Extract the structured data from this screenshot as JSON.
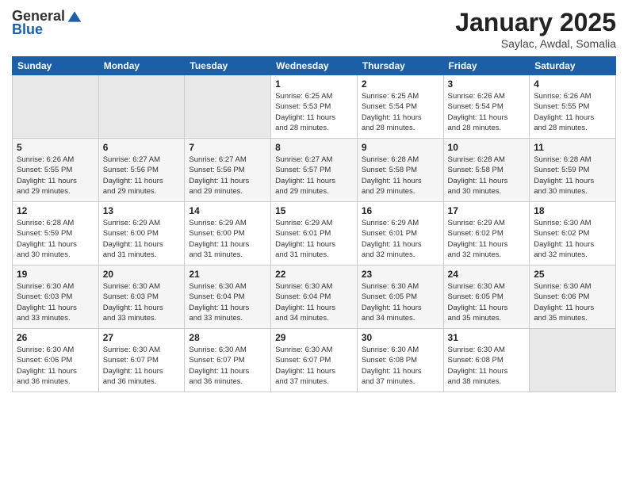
{
  "logo": {
    "general": "General",
    "blue": "Blue"
  },
  "header": {
    "month": "January 2025",
    "location": "Saylac, Awdal, Somalia"
  },
  "weekdays": [
    "Sunday",
    "Monday",
    "Tuesday",
    "Wednesday",
    "Thursday",
    "Friday",
    "Saturday"
  ],
  "weeks": [
    [
      {
        "day": "",
        "info": ""
      },
      {
        "day": "",
        "info": ""
      },
      {
        "day": "",
        "info": ""
      },
      {
        "day": "1",
        "info": "Sunrise: 6:25 AM\nSunset: 5:53 PM\nDaylight: 11 hours\nand 28 minutes."
      },
      {
        "day": "2",
        "info": "Sunrise: 6:25 AM\nSunset: 5:54 PM\nDaylight: 11 hours\nand 28 minutes."
      },
      {
        "day": "3",
        "info": "Sunrise: 6:26 AM\nSunset: 5:54 PM\nDaylight: 11 hours\nand 28 minutes."
      },
      {
        "day": "4",
        "info": "Sunrise: 6:26 AM\nSunset: 5:55 PM\nDaylight: 11 hours\nand 28 minutes."
      }
    ],
    [
      {
        "day": "5",
        "info": "Sunrise: 6:26 AM\nSunset: 5:55 PM\nDaylight: 11 hours\nand 29 minutes."
      },
      {
        "day": "6",
        "info": "Sunrise: 6:27 AM\nSunset: 5:56 PM\nDaylight: 11 hours\nand 29 minutes."
      },
      {
        "day": "7",
        "info": "Sunrise: 6:27 AM\nSunset: 5:56 PM\nDaylight: 11 hours\nand 29 minutes."
      },
      {
        "day": "8",
        "info": "Sunrise: 6:27 AM\nSunset: 5:57 PM\nDaylight: 11 hours\nand 29 minutes."
      },
      {
        "day": "9",
        "info": "Sunrise: 6:28 AM\nSunset: 5:58 PM\nDaylight: 11 hours\nand 29 minutes."
      },
      {
        "day": "10",
        "info": "Sunrise: 6:28 AM\nSunset: 5:58 PM\nDaylight: 11 hours\nand 30 minutes."
      },
      {
        "day": "11",
        "info": "Sunrise: 6:28 AM\nSunset: 5:59 PM\nDaylight: 11 hours\nand 30 minutes."
      }
    ],
    [
      {
        "day": "12",
        "info": "Sunrise: 6:28 AM\nSunset: 5:59 PM\nDaylight: 11 hours\nand 30 minutes."
      },
      {
        "day": "13",
        "info": "Sunrise: 6:29 AM\nSunset: 6:00 PM\nDaylight: 11 hours\nand 31 minutes."
      },
      {
        "day": "14",
        "info": "Sunrise: 6:29 AM\nSunset: 6:00 PM\nDaylight: 11 hours\nand 31 minutes."
      },
      {
        "day": "15",
        "info": "Sunrise: 6:29 AM\nSunset: 6:01 PM\nDaylight: 11 hours\nand 31 minutes."
      },
      {
        "day": "16",
        "info": "Sunrise: 6:29 AM\nSunset: 6:01 PM\nDaylight: 11 hours\nand 32 minutes."
      },
      {
        "day": "17",
        "info": "Sunrise: 6:29 AM\nSunset: 6:02 PM\nDaylight: 11 hours\nand 32 minutes."
      },
      {
        "day": "18",
        "info": "Sunrise: 6:30 AM\nSunset: 6:02 PM\nDaylight: 11 hours\nand 32 minutes."
      }
    ],
    [
      {
        "day": "19",
        "info": "Sunrise: 6:30 AM\nSunset: 6:03 PM\nDaylight: 11 hours\nand 33 minutes."
      },
      {
        "day": "20",
        "info": "Sunrise: 6:30 AM\nSunset: 6:03 PM\nDaylight: 11 hours\nand 33 minutes."
      },
      {
        "day": "21",
        "info": "Sunrise: 6:30 AM\nSunset: 6:04 PM\nDaylight: 11 hours\nand 33 minutes."
      },
      {
        "day": "22",
        "info": "Sunrise: 6:30 AM\nSunset: 6:04 PM\nDaylight: 11 hours\nand 34 minutes."
      },
      {
        "day": "23",
        "info": "Sunrise: 6:30 AM\nSunset: 6:05 PM\nDaylight: 11 hours\nand 34 minutes."
      },
      {
        "day": "24",
        "info": "Sunrise: 6:30 AM\nSunset: 6:05 PM\nDaylight: 11 hours\nand 35 minutes."
      },
      {
        "day": "25",
        "info": "Sunrise: 6:30 AM\nSunset: 6:06 PM\nDaylight: 11 hours\nand 35 minutes."
      }
    ],
    [
      {
        "day": "26",
        "info": "Sunrise: 6:30 AM\nSunset: 6:06 PM\nDaylight: 11 hours\nand 36 minutes."
      },
      {
        "day": "27",
        "info": "Sunrise: 6:30 AM\nSunset: 6:07 PM\nDaylight: 11 hours\nand 36 minutes."
      },
      {
        "day": "28",
        "info": "Sunrise: 6:30 AM\nSunset: 6:07 PM\nDaylight: 11 hours\nand 36 minutes."
      },
      {
        "day": "29",
        "info": "Sunrise: 6:30 AM\nSunset: 6:07 PM\nDaylight: 11 hours\nand 37 minutes."
      },
      {
        "day": "30",
        "info": "Sunrise: 6:30 AM\nSunset: 6:08 PM\nDaylight: 11 hours\nand 37 minutes."
      },
      {
        "day": "31",
        "info": "Sunrise: 6:30 AM\nSunset: 6:08 PM\nDaylight: 11 hours\nand 38 minutes."
      },
      {
        "day": "",
        "info": ""
      }
    ]
  ]
}
